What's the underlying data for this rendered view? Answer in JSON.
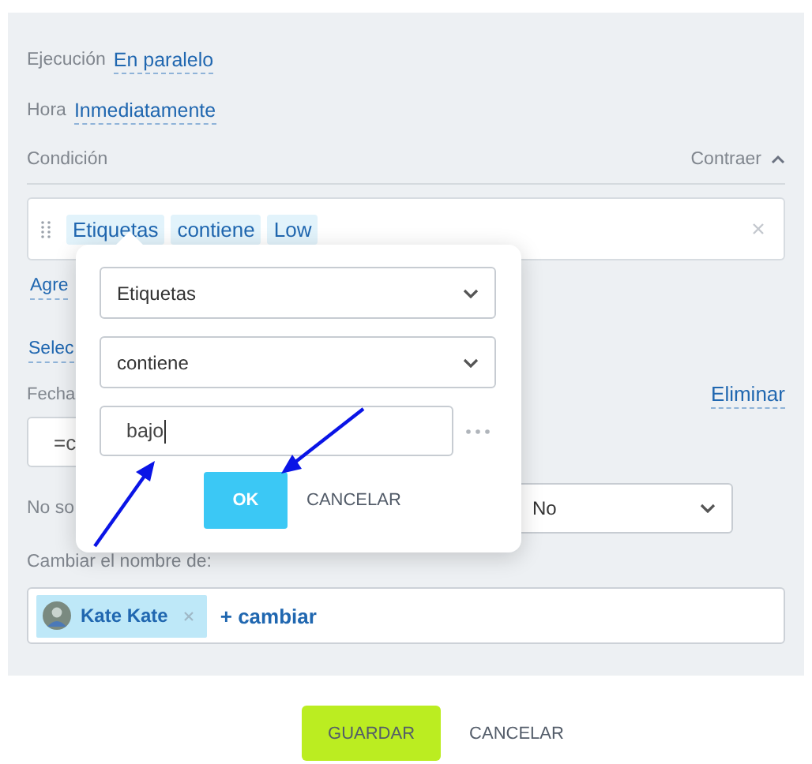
{
  "fields": [
    {
      "label": "Ejecución",
      "value": "En paralelo"
    },
    {
      "label": "Hora",
      "value": "Inmediatamente"
    }
  ],
  "condition": {
    "label": "Condición",
    "toggle": "Contraer",
    "expanded": true,
    "tokens": [
      "Etiquetas",
      "contiene",
      "Low"
    ]
  },
  "links": [
    "Agre",
    "Selec"
  ],
  "date": {
    "label": "Fecha",
    "action": "Eliminar",
    "value": "=c"
  },
  "option": {
    "label": "No so",
    "value": "No"
  },
  "rename": {
    "label": "Cambiar el nombre de:",
    "users": [
      {
        "name": "Kate Kate"
      }
    ],
    "add": "+ cambiar"
  },
  "popup": {
    "field": "Etiquetas",
    "operator": "contiene",
    "value": "bajo",
    "ok": "OK",
    "cancel": "CANCELAR"
  },
  "footer": {
    "save": "GUARDAR",
    "cancel": "CANCELAR"
  }
}
